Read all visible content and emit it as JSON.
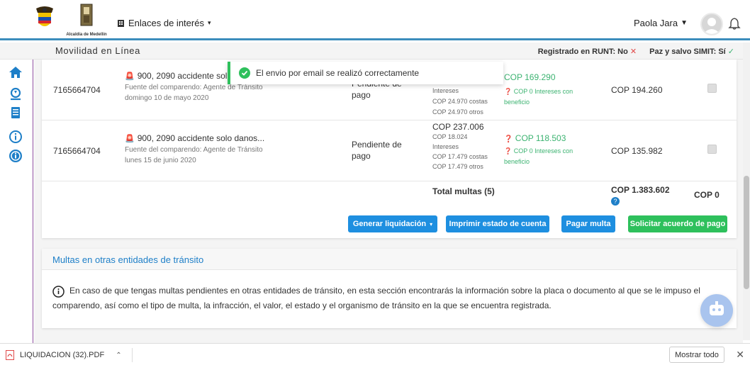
{
  "header": {
    "logo_caption": "Alcaldía de Medellín",
    "links_label": "Enlaces de interés",
    "user_name": "Paola Jara"
  },
  "subheader": {
    "title": "Movilidad en Línea",
    "runt_label": "Registrado en RUNT: No",
    "simit_label": "Paz y salvo SIMIT: Sí"
  },
  "toast": {
    "message": "El envio por email se realizó correctamente"
  },
  "fines": {
    "rows": [
      {
        "id": "7165664704",
        "title": "900, 2090 accidente solo",
        "source": "Fuente del comparendo: Agente de Tránsito",
        "date": "domingo 10 de mayo 2020",
        "status": "Pendiente de pago",
        "amount": "",
        "interests_value": "",
        "interests_label": "Intereses",
        "costs": "COP 24.970 costas",
        "others": "COP 24.970 otros",
        "discount": "COP 169.290",
        "discount_note": "COP 0 Intereses con beneficio",
        "total": "COP 194.260"
      },
      {
        "id": "7165664704",
        "title": "900, 2090 accidente solo danos...",
        "source": "Fuente del comparendo: Agente de Tránsito",
        "date": "lunes 15 de junio 2020",
        "status": "Pendiente de pago",
        "amount": "COP 237.006",
        "interests_value": "COP 18.024",
        "interests_label": "Intereses",
        "costs": "COP 17.479 costas",
        "others": "COP 17.479 otros",
        "discount": "COP 118.503",
        "discount_note": "COP 0 Intereses con beneficio",
        "total": "COP 135.982"
      }
    ],
    "total_label": "Total multas (5)",
    "total_value": "COP 1.383.602",
    "selected_total": "COP 0"
  },
  "actions": {
    "generate": "Generar liquidación",
    "print": "Imprimir estado de cuenta",
    "pay": "Pagar multa",
    "agreement": "Solicitar acuerdo de pago"
  },
  "other_entities": {
    "title": "Multas en otras entidades de tránsito",
    "text": "En caso de que tengas multas pendientes en otras entidades de tránsito, en esta sección encontrarás la información sobre la placa o documento al que se le impuso el comparendo, así como el tipo de multa, la infracción, el valor, el estado y el organismo de tránsito en la que se encuentra registrada."
  },
  "download_bar": {
    "file_name": "LIQUIDACION (32).PDF",
    "show_all": "Mostrar todo"
  },
  "colors": {
    "primary_blue": "#1e8fe0",
    "success_green": "#2ec05c",
    "link_blue": "#1e7fc8"
  }
}
